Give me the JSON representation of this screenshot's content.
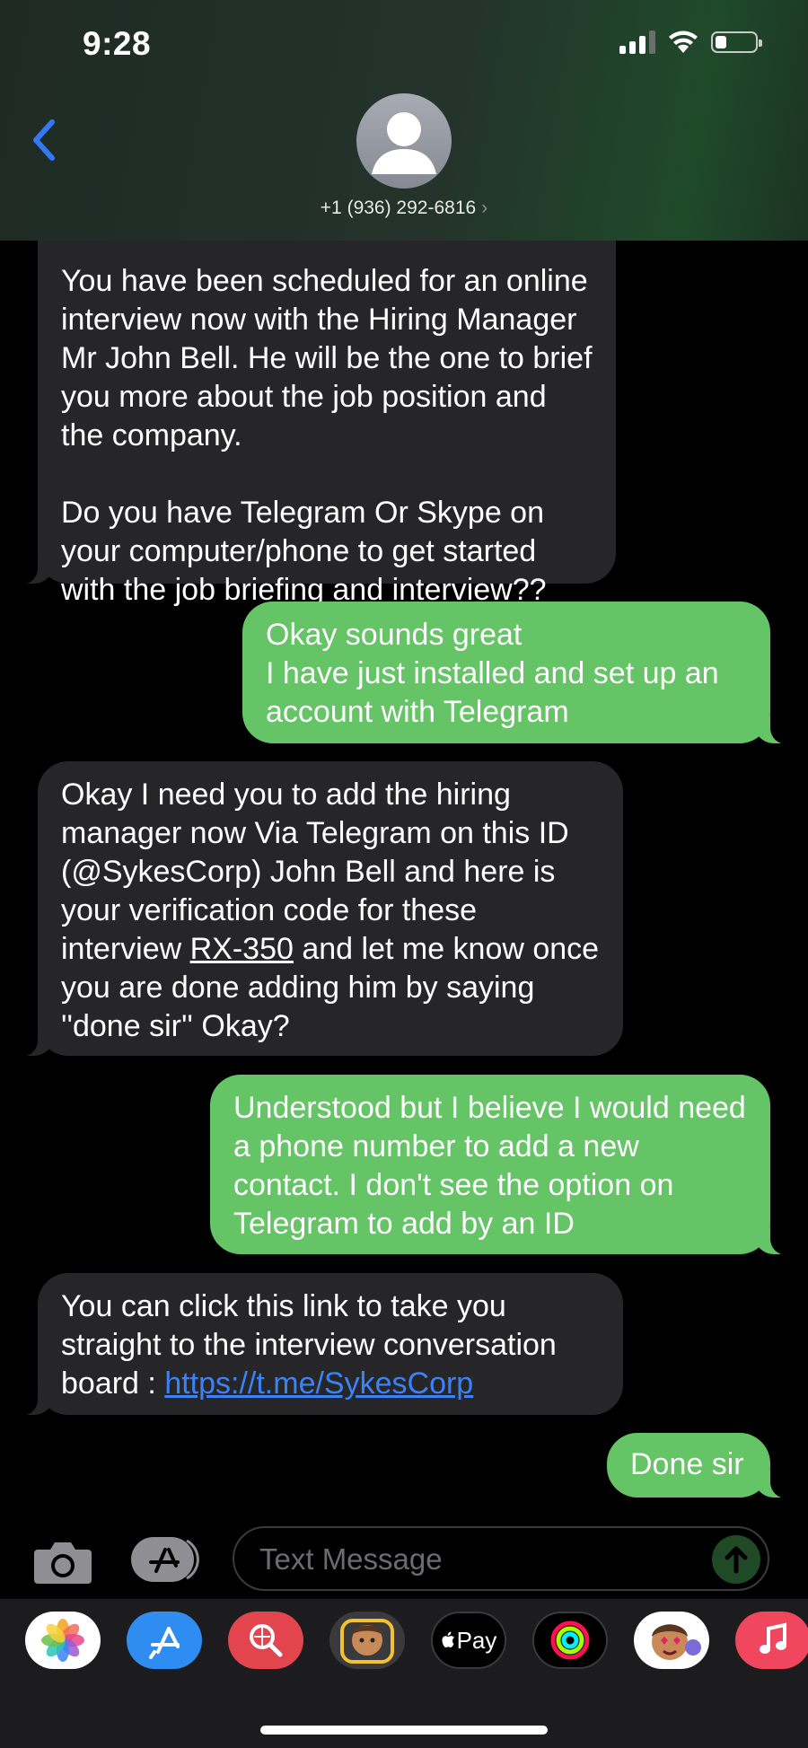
{
  "status_bar": {
    "time": "9:28"
  },
  "header": {
    "contact": "+1 (936) 292-6816"
  },
  "messages": {
    "m1": {
      "p1": "You have been scheduled for an online interview now with the Hiring Manager Mr John Bell. He will be the one to brief you more about the job position and the company.",
      "p2": "Do you have Telegram Or Skype on your computer/phone to get started with the job briefing and interview??"
    },
    "m2": {
      "p1": "Okay sounds great",
      "p2": "I have just installed and set up an account with Telegram"
    },
    "m3": {
      "before": "Okay I need you to add the hiring manager now Via Telegram on this ID (@SykesCorp) John Bell and here is your verification code for these interview ",
      "code": "RX-350",
      "after": " and let me know once you are done adding him by saying ''done sir'' Okay?"
    },
    "m4": "Understood but I believe I would need a phone number to add a new contact. I don't see the option on Telegram to add by an ID",
    "m5": {
      "text": "You can click this link to take you straight to the interview conversation board : ",
      "link": "https://t.me/SykesCorp"
    },
    "m6": "Done sir"
  },
  "input": {
    "placeholder": "Text Message"
  },
  "app_drawer": {
    "apps": [
      "photos-icon",
      "app-store-icon",
      "web-search-icon",
      "memoji-icon",
      "apple-pay-icon",
      "fitness-icon",
      "stickers-icon",
      "music-icon"
    ],
    "apple_pay_label": "Pay"
  },
  "colors": {
    "outgoing": "#65c466",
    "incoming": "#262628",
    "link": "#3b82f6",
    "accent": "#3478f6"
  }
}
